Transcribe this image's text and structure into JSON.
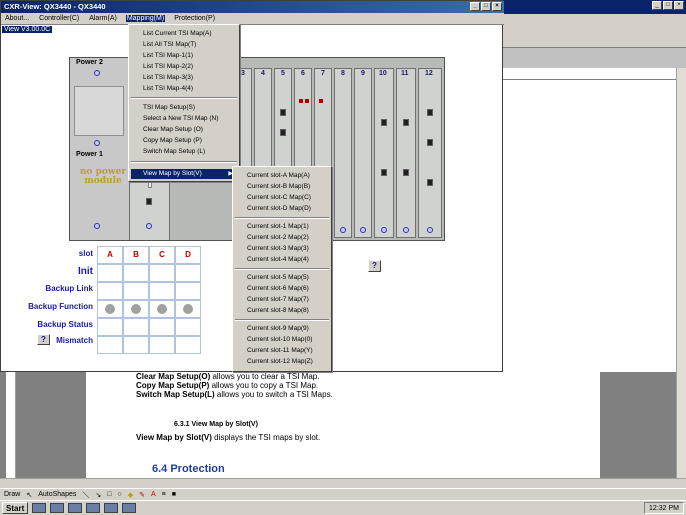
{
  "cxr": {
    "title": "CXR-View: QX3440 - QX3440",
    "version": "View V3.00.0C",
    "menus": [
      "About...",
      "Controller(C)",
      "Alarm(A)",
      "Mapping(M)",
      "Protection(P)"
    ]
  },
  "mapping_menu": {
    "group1": [
      "List Current TSI Map(A)",
      "List All TSI Map(T)",
      "List TSI Map-1(1)",
      "List TSI Map-2(2)",
      "List TSI Map-3(3)",
      "List TSI Map-4(4)"
    ],
    "group2": [
      "TSI Map Setup(S)",
      "Select a New TSI Map (N)",
      "Clear Map Setup (O)",
      "Copy Map Setup (P)",
      "Switch Map Setup (L)"
    ],
    "group3": [
      "View Map by Slot(V)"
    ]
  },
  "slot_submenu": {
    "groups": [
      [
        "Current slot-A Map(A)",
        "Current slot-B Map(B)",
        "Current slot-C Map(C)",
        "Current slot-D Map(D)"
      ],
      [
        "Current slot-1 Map(1)",
        "Current slot-2 Map(2)",
        "Current slot-3 Map(3)",
        "Current slot-4 Map(4)"
      ],
      [
        "Current slot-5 Map(5)",
        "Current slot-6 Map(6)",
        "Current slot-7 Map(7)",
        "Current slot-8 Map(8)"
      ],
      [
        "Current slot-9 Map(9)",
        "Current slot-10 Map(0)",
        "Current slot-11 Map(Y)",
        "Current slot-12 Map(Z)"
      ]
    ]
  },
  "chassis": {
    "power_label": "Power 2",
    "power_label_2": "Power 1",
    "no_power": "no power module",
    "slot_numbers": [
      "3",
      "4",
      "5",
      "6",
      "7",
      "8",
      "9",
      "10",
      "11",
      "12"
    ],
    "help": "?"
  },
  "slot_table": {
    "slot_label": "slot",
    "columns": [
      "A",
      "B",
      "C",
      "D"
    ],
    "rows": [
      "Init",
      "Backup Link",
      "Backup Function",
      "Backup Status",
      "Mismatch"
    ],
    "help": "?"
  },
  "document": {
    "line1_bold": "Clear Map Setup(O)",
    "line1_rest": " allows you to clear a TSI Map.",
    "line2_bold": "Copy Map Setup(P)",
    "line2_rest": " allows you to copy a TSI Map.",
    "line3_bold": "Switch Map Setup(L)",
    "line3_rest": " allows you to switch a TSI Maps.",
    "section": "6.3.1  View Map by Slot(V)",
    "line4_bold": "View Map by Slot(V)",
    "line4_rest": " displays the TSI maps by slot.",
    "heading": "6.4 Protection"
  },
  "draw_toolbar": {
    "draw": "Draw",
    "autoshapes": "AutoShapes"
  },
  "taskbar": {
    "start": "Start",
    "clock": "12:32 PM"
  }
}
